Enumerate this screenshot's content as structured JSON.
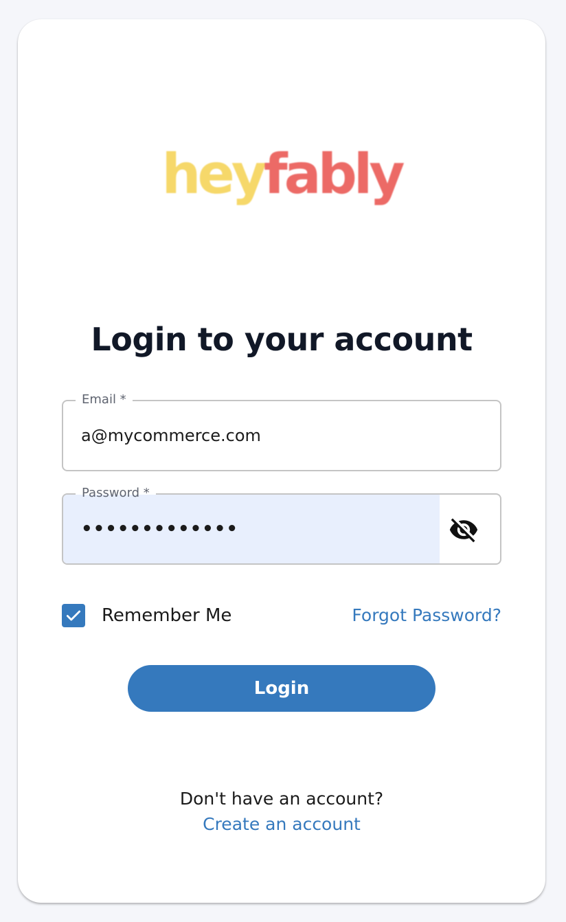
{
  "brand": {
    "logo_part1": "hey",
    "logo_part2": "fably",
    "colors": {
      "hey": "#f6d86a",
      "fably": "#ec6a66"
    }
  },
  "page": {
    "title": "Login to your account"
  },
  "form": {
    "email": {
      "label": "Email *",
      "value": "a@mycommerce.com"
    },
    "password": {
      "label": "Password *",
      "value": "•••••••••••••",
      "toggle_icon": "eye-off-icon"
    },
    "remember": {
      "label": "Remember Me",
      "checked": true
    },
    "forgot_label": "Forgot Password?",
    "submit_label": "Login"
  },
  "footer": {
    "prompt": "Don't have an account?",
    "create_label": "Create an account"
  },
  "colors": {
    "accent": "#3579bd",
    "autofill_bg": "#e8effd",
    "page_bg": "#f5f6fa"
  }
}
